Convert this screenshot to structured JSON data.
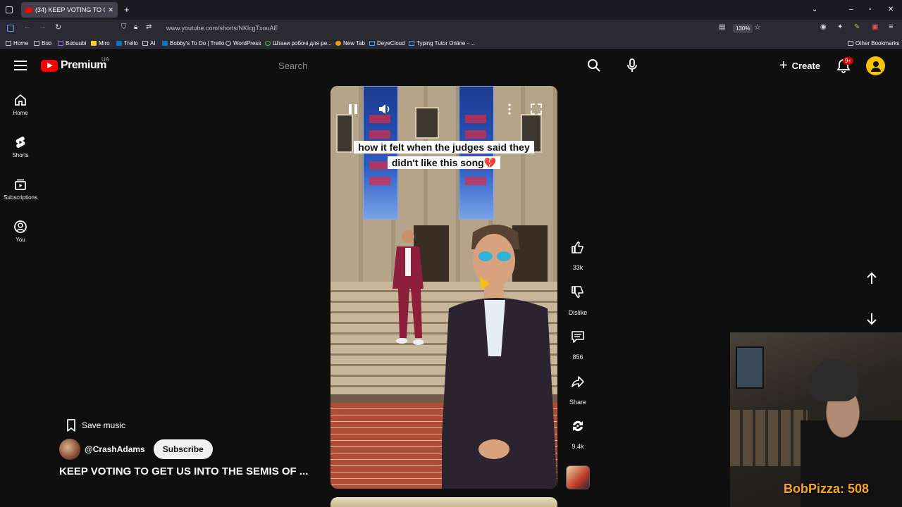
{
  "browser": {
    "tab_title": "(34) KEEP VOTING TO GET U",
    "url": "www.youtube.com/shorts/NKlcgTxouAE",
    "zoom": "130%",
    "bookmarks": [
      "Home",
      "Bob",
      "Bobuubi",
      "Miro",
      "Trello",
      "AI",
      "Bobby's To Do | Trello",
      "WordPress",
      "Штани робочі для ре...",
      "New Tab",
      "DeyeCloud",
      "Typing Tutor Online - ..."
    ],
    "other_bookmarks": "Other Bookmarks"
  },
  "header": {
    "logo_text": "Premium",
    "logo_region": "UA",
    "search_placeholder": "Search",
    "create_label": "Create",
    "notifications_badge": "9+"
  },
  "sidebar": {
    "items": [
      {
        "label": "Home",
        "icon": "home-icon"
      },
      {
        "label": "Shorts",
        "icon": "shorts-icon"
      },
      {
        "label": "Subscriptions",
        "icon": "subscriptions-icon"
      },
      {
        "label": "You",
        "icon": "you-icon"
      }
    ]
  },
  "video": {
    "caption": "how it felt when the judges said they didn't like this song💔"
  },
  "actions": {
    "likes": "33k",
    "dislike_label": "Dislike",
    "comments": "856",
    "share_label": "Share",
    "remix": "9.4k"
  },
  "channel": {
    "save_music": "Save music",
    "handle": "@CrashAdams",
    "subscribe_label": "Subscribe",
    "title": "KEEP VOTING TO GET US INTO THE SEMIS OF ..."
  },
  "overlay": {
    "stream_text": "BobPizza: 508"
  }
}
